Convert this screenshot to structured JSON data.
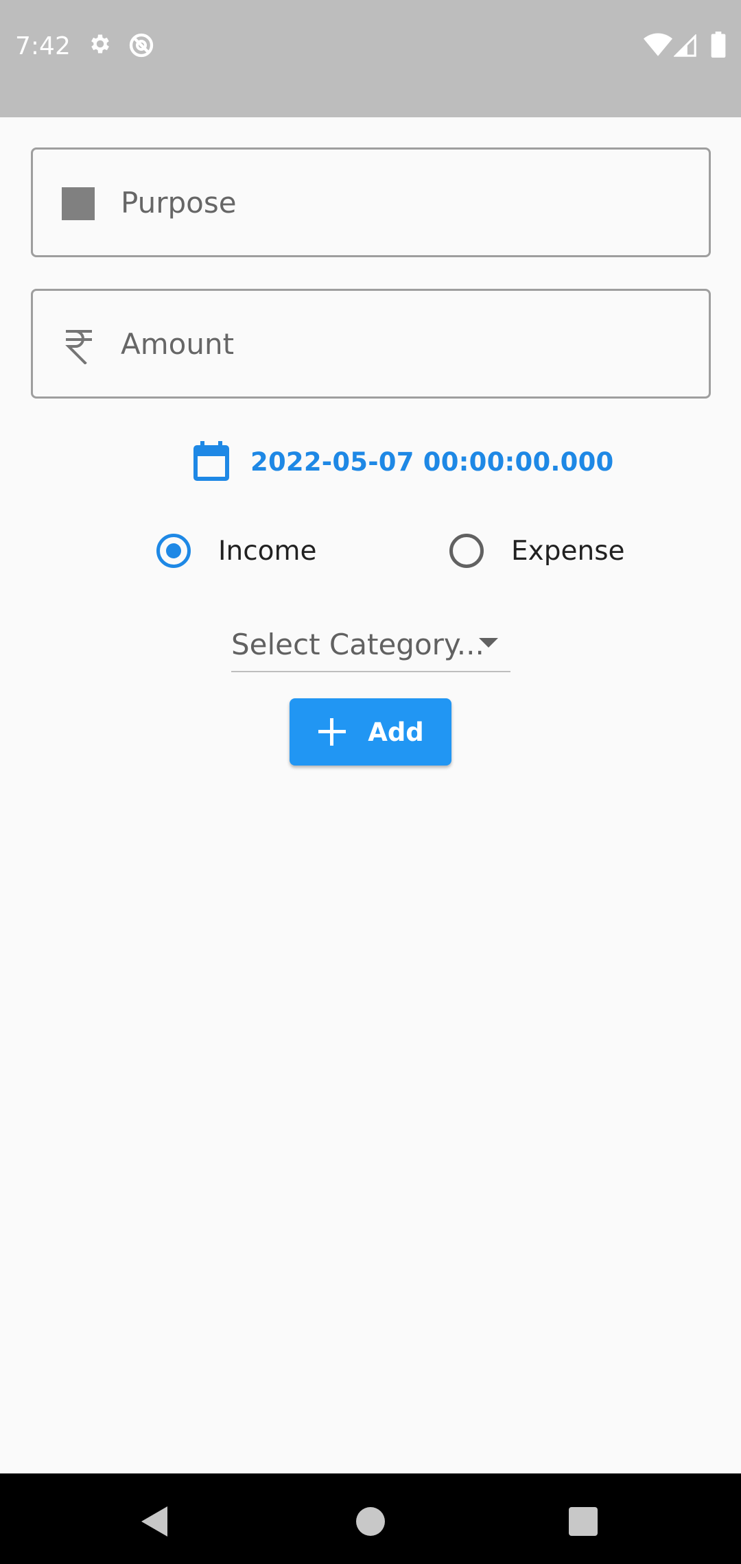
{
  "status_bar": {
    "time": "7:42",
    "left_icons": [
      "settings-icon",
      "do-not-disturb-icon"
    ],
    "right_icons": [
      "wifi-icon",
      "signal-icon",
      "battery-icon"
    ]
  },
  "form": {
    "purpose": {
      "placeholder": "Purpose",
      "value": "",
      "icon": "square-icon"
    },
    "amount": {
      "placeholder": "Amount",
      "value": "",
      "icon": "rupee-icon"
    },
    "date": {
      "value": "2022-05-07 00:00:00.000",
      "icon": "calendar-icon"
    },
    "type_options": [
      {
        "label": "Income",
        "selected": true
      },
      {
        "label": "Expense",
        "selected": false
      }
    ],
    "category": {
      "placeholder": "Select Category...",
      "icon": "arrow-drop-down-icon"
    },
    "add_button": {
      "label": "Add",
      "icon": "plus-icon"
    }
  },
  "nav_bar": {
    "buttons": [
      "back-icon",
      "home-icon",
      "recents-icon"
    ]
  },
  "colors": {
    "accent": "#1e88e5",
    "button": "#2196f3",
    "status_bar": "#bdbdbd",
    "background": "#fafafa"
  }
}
